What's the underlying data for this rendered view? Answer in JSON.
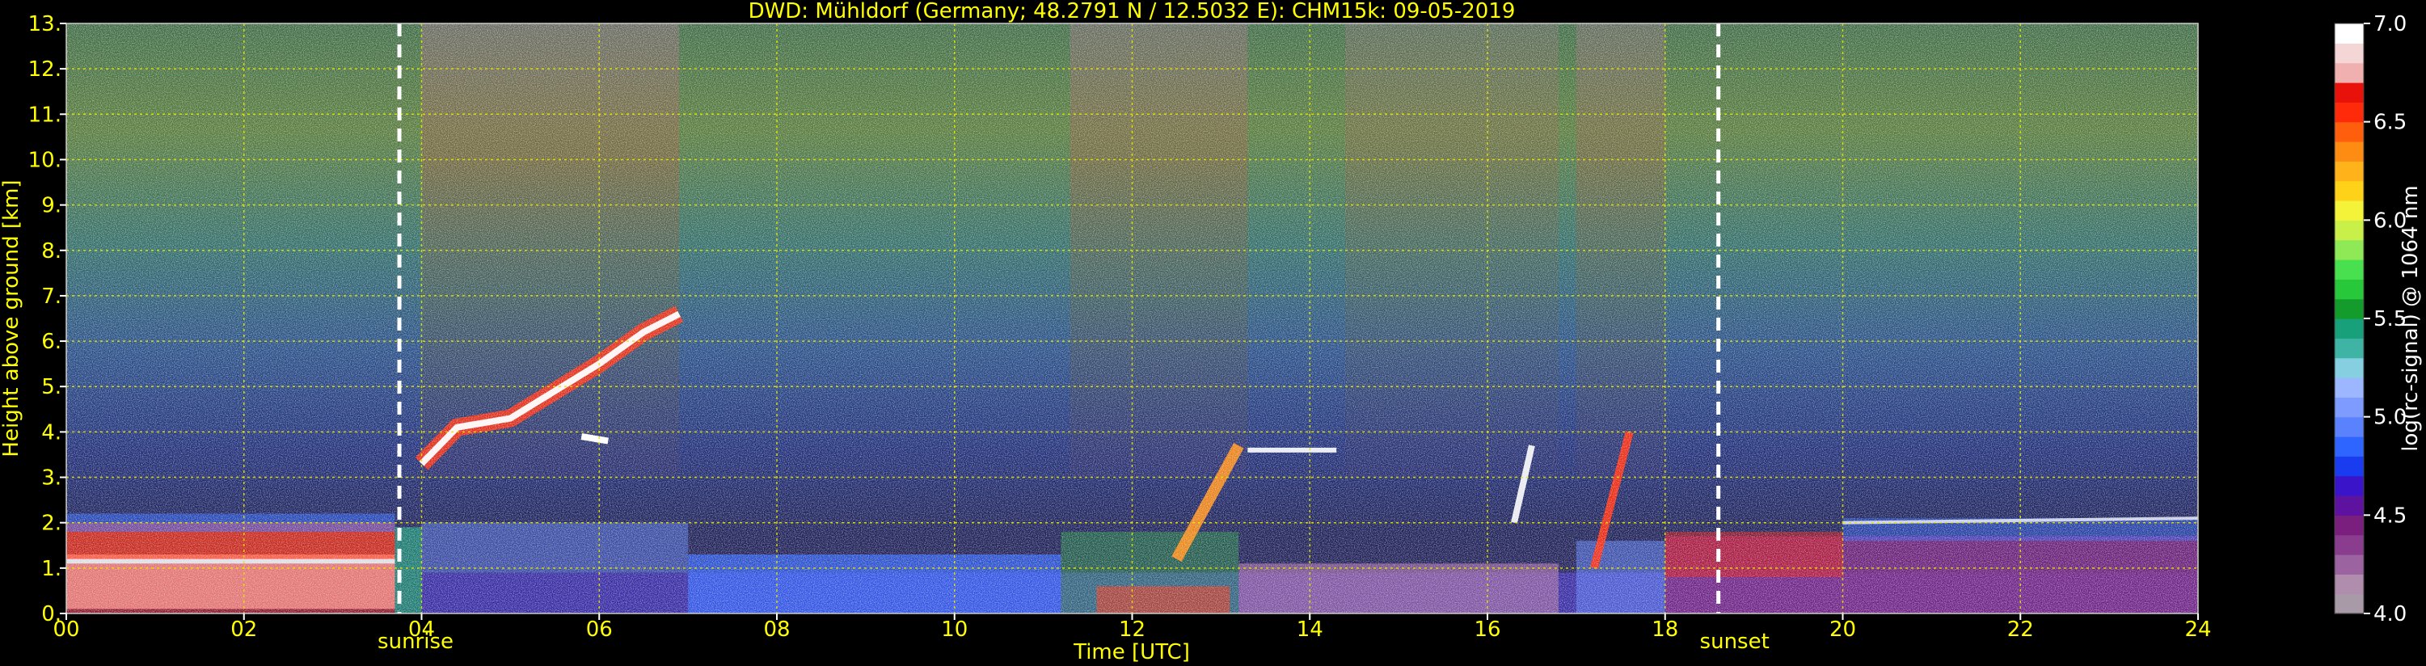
{
  "chart_data": {
    "type": "heatmap",
    "title": "DWD: Mühldorf (Germany; 48.2791 N / 12.5032 E):    CHM15k: 09-05-2019",
    "xlabel": "Time [UTC]",
    "ylabel": "Height above ground [km]",
    "xlim": [
      0,
      24
    ],
    "ylim": [
      0,
      13
    ],
    "x_ticks": [
      0,
      2,
      4,
      6,
      8,
      10,
      12,
      14,
      16,
      18,
      20,
      22,
      24
    ],
    "x_tick_labels": [
      "00",
      "02",
      "04",
      "06",
      "08",
      "10",
      "12",
      "14",
      "16",
      "18",
      "20",
      "22",
      "24"
    ],
    "y_ticks": [
      0,
      1,
      2,
      3,
      4,
      5,
      6,
      7,
      8,
      9,
      10,
      11,
      12,
      13
    ],
    "y_tick_labels": [
      "0.",
      "1.",
      "2.",
      "3.",
      "4.",
      "5.",
      "6.",
      "7.",
      "8.",
      "9.",
      "10.",
      "11.",
      "12.",
      "13."
    ],
    "grid": true,
    "annotations": [
      {
        "label": "sunrise",
        "x": 3.75
      },
      {
        "label": "sunset",
        "x": 18.6
      }
    ],
    "colorbar": {
      "label": "log(rc-signal) @ 1064 nm",
      "range": [
        4.0,
        7.0
      ],
      "ticks": [
        4.0,
        4.5,
        5.0,
        5.5,
        6.0,
        6.5,
        7.0
      ],
      "tick_labels": [
        "4.0",
        "4.5",
        "5.0",
        "5.5",
        "6.0",
        "6.5",
        "7.0"
      ],
      "colors": [
        "#a89aa6",
        "#b08cad",
        "#9b64a0",
        "#8a3c8e",
        "#7a1f7e",
        "#5d12a0",
        "#3a14c8",
        "#1a3cf0",
        "#2e64ff",
        "#5a82ff",
        "#7e9cff",
        "#9cb6ff",
        "#86cfe0",
        "#3fb3a4",
        "#18a07a",
        "#139c2c",
        "#27c83a",
        "#49e04f",
        "#8fe855",
        "#c8f049",
        "#f4f33a",
        "#ffd21a",
        "#ffb21a",
        "#ff8c12",
        "#ff5f0d",
        "#ff2a0a",
        "#e8120a",
        "#f0b0b0",
        "#f4d6d6",
        "#ffffff"
      ]
    }
  }
}
